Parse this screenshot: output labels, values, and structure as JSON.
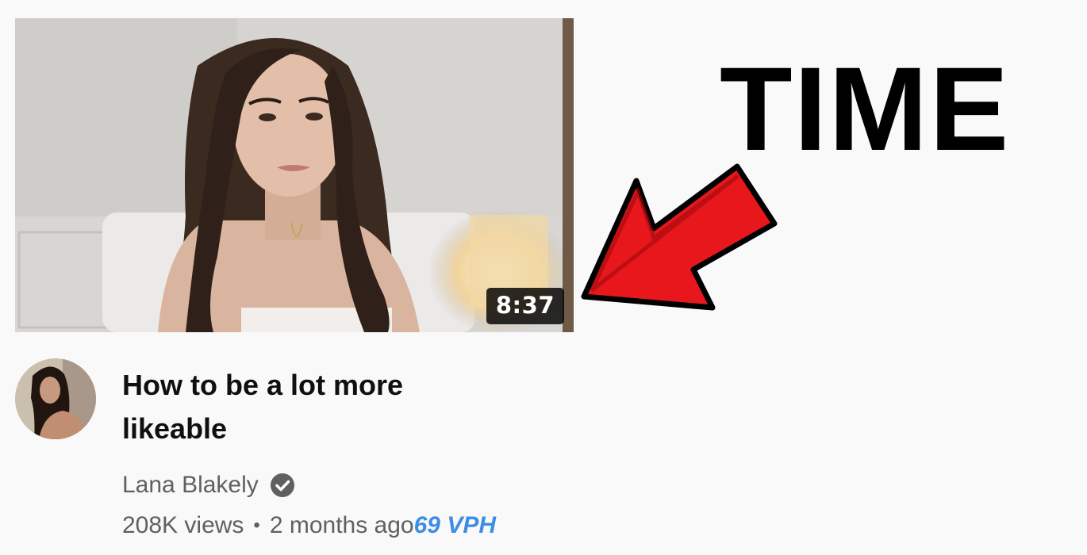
{
  "video": {
    "duration": "8:37",
    "title": "How to be a lot more likeable",
    "channel": "Lana Blakely",
    "views": "208K views",
    "separator": "•",
    "age": "2 months ago",
    "vph": "69 VPH",
    "verified_icon": "check-circle-icon"
  },
  "annotation": {
    "label": "TIME",
    "arrow_color": "#e8171c"
  },
  "colors": {
    "background": "#f9f9f9",
    "meta_text": "#606060",
    "vph_text": "#3d8de3"
  }
}
